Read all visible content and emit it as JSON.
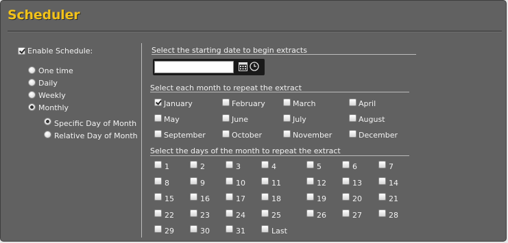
{
  "title": "Scheduler",
  "enable_schedule": {
    "label": "Enable Schedule:",
    "checked": true
  },
  "frequency": {
    "options": [
      {
        "label": "One time",
        "checked": false
      },
      {
        "label": "Daily",
        "checked": false
      },
      {
        "label": "Weekly",
        "checked": false
      },
      {
        "label": "Monthly",
        "checked": true
      }
    ]
  },
  "monthly_mode": {
    "options": [
      {
        "label": "Specific Day of Month",
        "checked": true
      },
      {
        "label": "Relative Day of Month",
        "checked": false
      }
    ]
  },
  "start_date": {
    "header": "Select the starting date to begin extracts",
    "value": "",
    "calendar_icon": "calendar-icon",
    "clock_icon": "clock-icon"
  },
  "months": {
    "header": "Select each month to repeat the extract",
    "items": [
      {
        "label": "January",
        "checked": true
      },
      {
        "label": "February",
        "checked": false
      },
      {
        "label": "March",
        "checked": false
      },
      {
        "label": "April",
        "checked": false
      },
      {
        "label": "May",
        "checked": false
      },
      {
        "label": "June",
        "checked": false
      },
      {
        "label": "July",
        "checked": false
      },
      {
        "label": "August",
        "checked": false
      },
      {
        "label": "September",
        "checked": false
      },
      {
        "label": "October",
        "checked": false
      },
      {
        "label": "November",
        "checked": false
      },
      {
        "label": "December",
        "checked": false
      }
    ]
  },
  "days": {
    "header": "Select the days of the month to repeat the extract",
    "items": [
      "1",
      "2",
      "3",
      "4",
      "5",
      "6",
      "7",
      "8",
      "9",
      "10",
      "11",
      "12",
      "13",
      "14",
      "15",
      "16",
      "17",
      "18",
      "19",
      "20",
      "21",
      "22",
      "23",
      "24",
      "25",
      "26",
      "27",
      "28",
      "29",
      "30",
      "31",
      "Last"
    ]
  },
  "colors": {
    "title": "#f2c21a",
    "panel": "#616161",
    "text": "#f2f2f2"
  }
}
